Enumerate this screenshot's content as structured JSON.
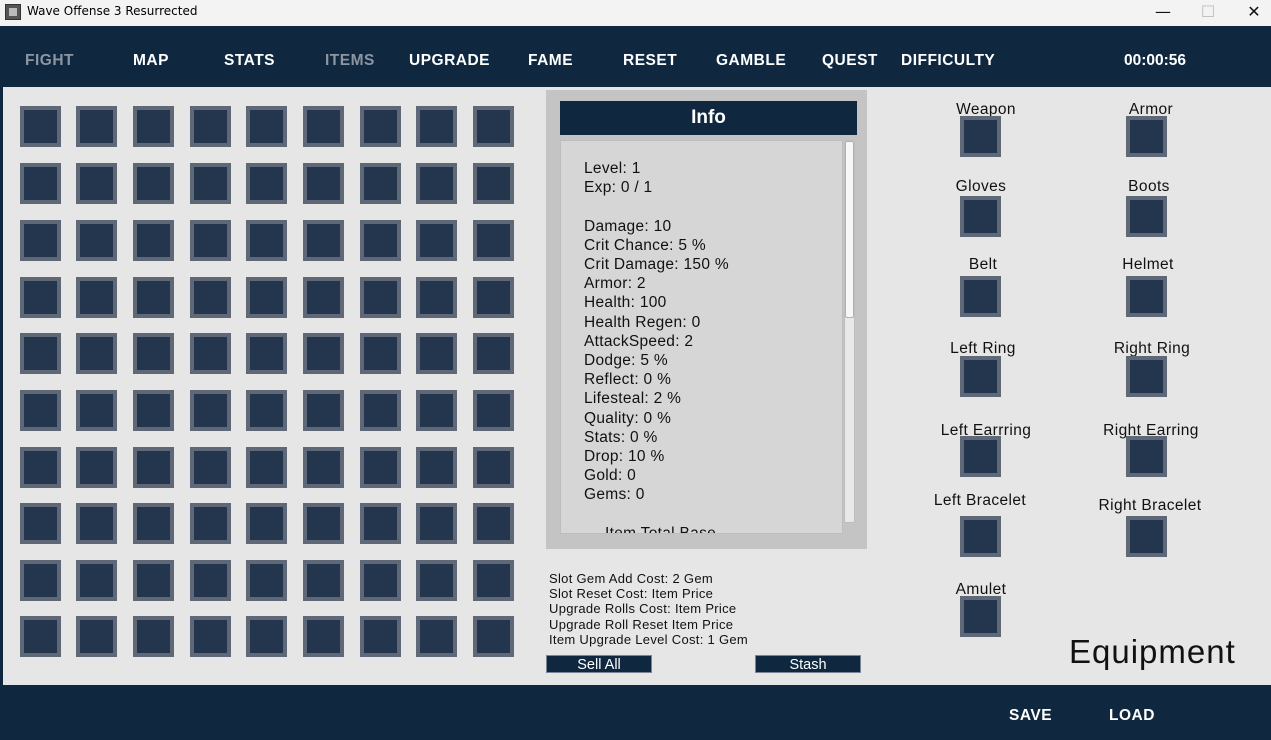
{
  "window": {
    "title": "Wave Offense 3 Resurrected",
    "minimize": "—",
    "maximize": "☐",
    "close": "✕"
  },
  "nav": [
    {
      "label": "FIGHT",
      "dim": true
    },
    {
      "label": "MAP",
      "dim": false
    },
    {
      "label": "STATS",
      "dim": false
    },
    {
      "label": "ITEMS",
      "dim": true
    },
    {
      "label": "UPGRADE",
      "dim": false
    },
    {
      "label": "FAME",
      "dim": false
    },
    {
      "label": "RESET",
      "dim": false
    },
    {
      "label": "GAMBLE",
      "dim": false
    },
    {
      "label": "QUEST",
      "dim": false
    },
    {
      "label": "DIFFICULTY",
      "dim": false
    }
  ],
  "timer": "00:00:56",
  "inventory": {
    "rows": 10,
    "cols": 9
  },
  "info": {
    "title": "Info",
    "lines": [
      "Level: 1",
      "Exp: 0 / 1",
      "",
      "Damage: 10",
      "Crit Chance: 5 %",
      "Crit Damage: 150 %",
      "Armor: 2",
      "Health: 100",
      "Health Regen: 0",
      "AttackSpeed: 2",
      "Dodge: 5 %",
      "Reflect: 0 %",
      "Lifesteal: 2 %",
      "Quality: 0 %",
      "Stats: 0 %",
      "Drop: 10 %",
      "Gold: 0",
      "Gems: 0",
      "",
      "--- Item Total Base ---"
    ]
  },
  "costs": [
    "Slot Gem Add Cost: 2 Gem",
    "Slot Reset Cost: Item Price",
    "Upgrade Rolls Cost: Item Price",
    "Upgrade Roll Reset Item Price",
    "Item Upgrade Level Cost: 1 Gem"
  ],
  "buttons": {
    "sell_all": "Sell All",
    "stash": "Stash"
  },
  "equipment": {
    "title": "Equipment",
    "slots": [
      "Weapon",
      "Armor",
      "Gloves",
      "Boots",
      "Belt",
      "Helmet",
      "Left Ring",
      "Right Ring",
      "Left Earrring",
      "Right Earring",
      "Left Bracelet",
      "Right Bracelet",
      "Amulet"
    ]
  },
  "footer": {
    "save": "SAVE",
    "load": "LOAD"
  }
}
